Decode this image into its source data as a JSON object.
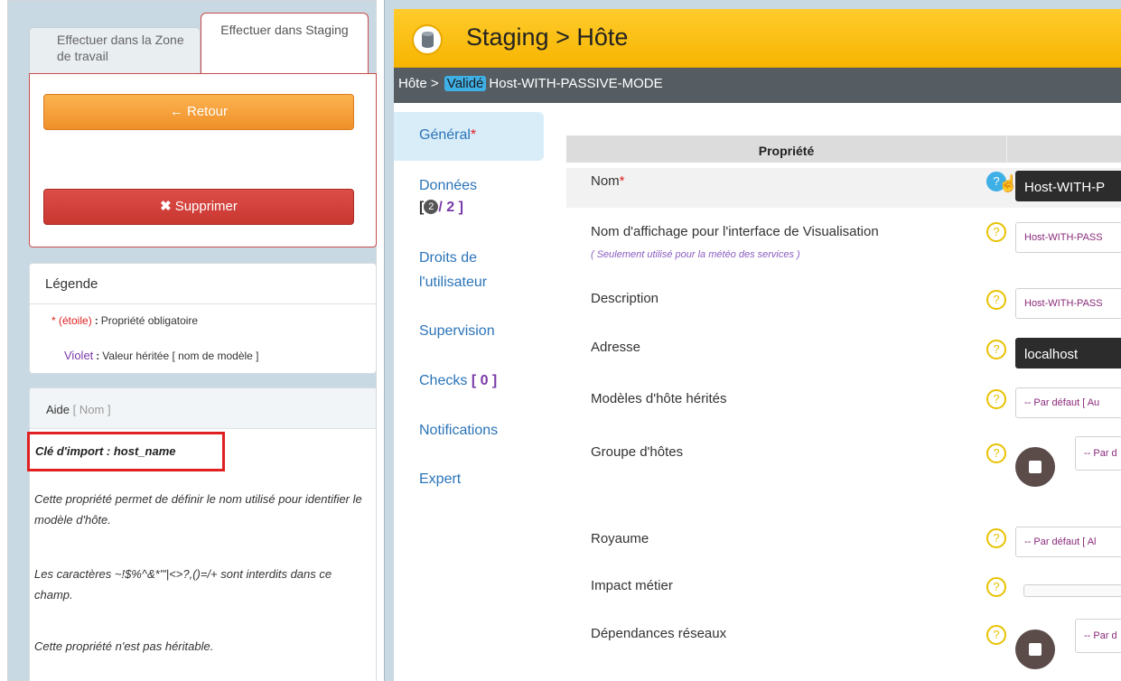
{
  "tabs": {
    "workspace": "Effectuer dans la Zone de travail",
    "staging": "Effectuer dans Staging"
  },
  "actions": {
    "back_label": "Retour",
    "back_glyph": "←",
    "delete_label": "Supprimer",
    "delete_glyph": "✖"
  },
  "legend": {
    "title": "Légende",
    "mandatory_key": "* (étoile)",
    "mandatory_text": "Propriété obligatoire",
    "inherited_key": "Violet",
    "inherited_text": "Valeur héritée [ nom de modèle ]",
    "separator": ":"
  },
  "help": {
    "title": "Aide",
    "context": "[ Nom ]",
    "import_key": "Clé d'import : host_name",
    "para1": "Cette propriété permet de définir le nom utilisé pour identifier le modèle d'hôte.",
    "para2": "Les caractères ~!$%^&*\"'|<>?,()=/+ sont interdits dans ce champ.",
    "para3": "Cette propriété n'est pas héritable."
  },
  "header": {
    "title": "Staging > Hôte",
    "icon": "database-icon"
  },
  "path": {
    "prefix": "Hôte >",
    "badge": "Validé",
    "name": "Host-WITH-PASSIVE-MODE"
  },
  "nav": {
    "general": "Général",
    "general_req": "*",
    "donnees": "Données",
    "donnees_count_open": "[",
    "donnees_count_current": "2",
    "donnees_count_total": "/ 2 ]",
    "droits_line1": "Droits de",
    "droits_line2": "l'utilisateur",
    "supervision": "Supervision",
    "checks": "Checks",
    "checks_count": "[ 0 ]",
    "notifications": "Notifications",
    "expert": "Expert"
  },
  "table": {
    "header": "Propriété",
    "rows": [
      {
        "label": "Nom",
        "required": "*",
        "value": "Host-WITH-P"
      },
      {
        "label": "Nom d'affichage pour l'interface de Visualisation",
        "sub": "( Seulement utilisé pour la météo des services )",
        "value": "Host-WITH-PASS"
      },
      {
        "label": "Description",
        "value": "Host-WITH-PASS"
      },
      {
        "label": "Adresse",
        "value": "localhost"
      },
      {
        "label": "Modèles d'hôte hérités",
        "value": "-- Par défaut [ Au"
      },
      {
        "label": "Groupe d'hôtes",
        "value": "-- Par d"
      },
      {
        "label": "Royaume",
        "value": "-- Par défaut [ Al"
      },
      {
        "label": "Impact métier",
        "value": ""
      },
      {
        "label": "Dépendances réseaux",
        "value": "-- Par d"
      }
    ],
    "help_glyph": "?"
  }
}
